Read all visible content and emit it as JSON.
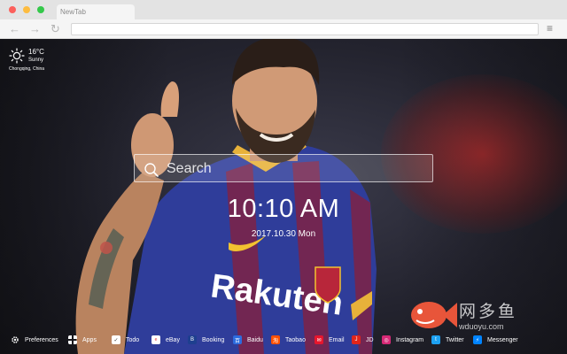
{
  "browser": {
    "tab_title": "NewTab",
    "back_icon": "←",
    "forward_icon": "→",
    "reload_icon": "↻",
    "menu_icon": "≡"
  },
  "weather": {
    "temperature": "16°C",
    "condition": "Sunny",
    "location": "Chongqing, China",
    "icon": "sun-icon"
  },
  "search": {
    "placeholder": "Search"
  },
  "clock": {
    "time": "10:10 AM",
    "date": "2017.10.30 Mon"
  },
  "bottom_bar": {
    "items": [
      {
        "label": "Preferences",
        "icon": "gear-icon",
        "color": "#ffffff"
      },
      {
        "label": "Apps",
        "icon": "grid-icon",
        "color": "#ffffff"
      },
      {
        "label": "Todo",
        "icon": "checkbox-icon",
        "color": "#ffffff"
      },
      {
        "label": "eBay",
        "icon": "ebay-icon",
        "color": "#ffffff"
      },
      {
        "label": "Booking",
        "icon": "booking-icon",
        "color": "#1e3f8f"
      },
      {
        "label": "Baidu",
        "icon": "baidu-icon",
        "color": "#2d6cdf"
      },
      {
        "label": "Taobao",
        "icon": "taobao-icon",
        "color": "#ff5000"
      },
      {
        "label": "Email",
        "icon": "mail-icon",
        "color": "#e6162d"
      },
      {
        "label": "JD",
        "icon": "jd-icon",
        "color": "#e1251b"
      },
      {
        "label": "Instagram",
        "icon": "instagram-icon",
        "color": "#d62976"
      },
      {
        "label": "Twitter",
        "icon": "twitter-icon",
        "color": "#1da1f2"
      },
      {
        "label": "Messenger",
        "icon": "messenger-icon",
        "color": "#0084ff"
      }
    ]
  },
  "watermark": {
    "text": "网多鱼",
    "url": "wduoyu.com"
  }
}
